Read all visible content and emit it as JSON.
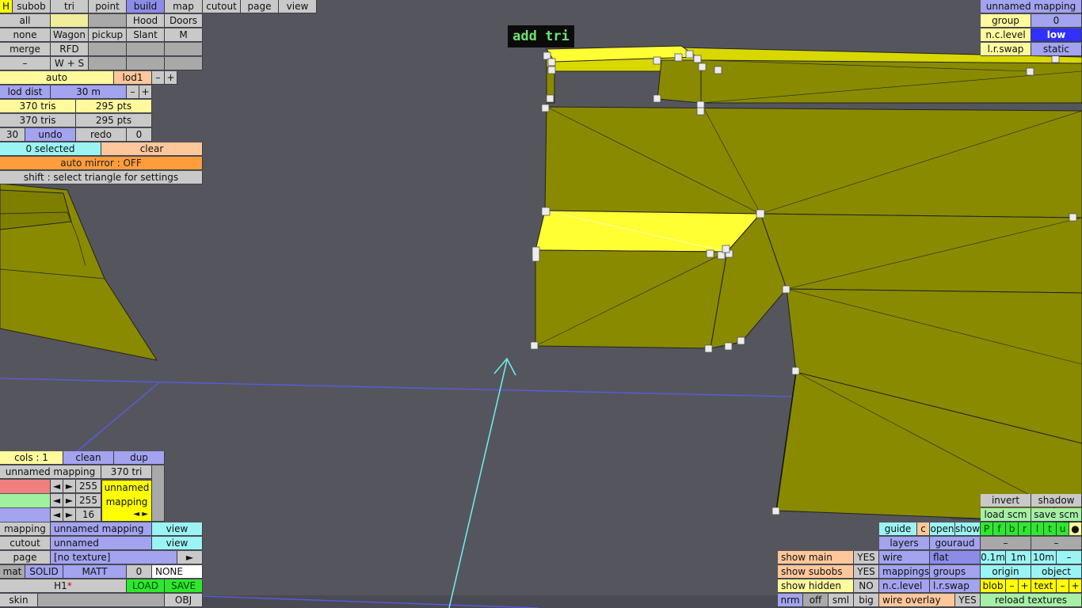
{
  "hud_label": "add tri",
  "top_menu": {
    "h": "H",
    "subob": "subob",
    "tri": "tri",
    "point": "point",
    "build": "build",
    "map": "map",
    "cutout": "cutout",
    "page": "page",
    "view": "view"
  },
  "left_panel": {
    "r1": [
      "all",
      "",
      "",
      "Hood",
      "Doors"
    ],
    "r2": [
      "none",
      "Wagon",
      "pickup",
      "Slant",
      "M"
    ],
    "r3": [
      "merge",
      "RFD",
      "",
      "",
      ""
    ],
    "r4": [
      "–",
      "W + S",
      "",
      "",
      ""
    ],
    "auto": "auto",
    "lod1": "lod1",
    "minus": "–",
    "plus": "+",
    "lod_dist": "lod dist",
    "lod_value": "30 m",
    "tris1": "370 tris",
    "pts1": "295 pts",
    "tris2": "370 tris",
    "pts2": "295 pts",
    "undo_count": "30",
    "undo": "undo",
    "redo": "redo",
    "redo_count": "0",
    "selected": "0 selected",
    "clear": "clear",
    "auto_mirror": "auto mirror : OFF",
    "hint": "shift : select triangle for settings"
  },
  "bottom_left": {
    "cols": "cols : 1",
    "clean": "clean",
    "dup": "dup",
    "mapping_name": "unnamed mapping",
    "tri_count": "370 tri",
    "r_val": "255",
    "g_val": "255",
    "b_val": "16",
    "mapping_box_1": "unnamed",
    "mapping_box_2": "mapping",
    "left_arrow": "◄",
    "right_arrow": "►",
    "mapping_label": "mapping",
    "mapping_value": "unnamed mapping",
    "view1": "view",
    "cutout_label": "cutout",
    "cutout_value": "unnamed",
    "view2": "view",
    "page_label": "page",
    "page_value": "[no texture]",
    "page_arrow": "►",
    "mat": "mat",
    "solid": "SOLID",
    "matt": "MATT",
    "mat_num": "0",
    "none": "NONE",
    "h1": "H1",
    "h1_mark": "*",
    "load": "LOAD",
    "save": "SAVE",
    "skin": "skin",
    "obj": "OBJ"
  },
  "top_right": {
    "unnamed_mapping": "unnamed mapping",
    "group": "group",
    "group_val": "0",
    "nclevel": "n.c.level",
    "nclevel_val": "low",
    "lrswap": "l.r.swap",
    "lrswap_val": "static"
  },
  "bottom_right": {
    "invert": "invert",
    "shadow": "shadow",
    "load_scm": "load scm",
    "save_scm": "save scm",
    "guide": "guide",
    "c": "c",
    "open": "open",
    "show": "show",
    "pfbrltu": [
      "P",
      "f",
      "b",
      "r",
      "l",
      "t",
      "u"
    ],
    "dot": "●",
    "layers": "layers",
    "gouraud": "gouraud",
    "dash1": "–",
    "dash2": "–",
    "show_main": "show main",
    "yes1": "YES",
    "wire": "wire",
    "flat": "flat",
    "m01": "0.1m",
    "m1": "1m",
    "m10": "10m",
    "mdash": "–",
    "show_subobs": "show subobs",
    "yes2": "YES",
    "mappings": "mappings",
    "groups": "groups",
    "origin": "origin",
    "object": "object",
    "show_hidden": "show hidden",
    "no": "NO",
    "nclevel": "n.c.level",
    "lrswap": "l.r.swap",
    "blob": "blob",
    "blob_minus": "–",
    "blob_plus": "+",
    "text": "text",
    "text_minus": "–",
    "text_plus": "+",
    "nrm": "nrm",
    "off": "off",
    "sml": "sml",
    "big": "big",
    "wire_overlay": "wire overlay",
    "yes3": "YES",
    "reload_textures": "reload textures"
  },
  "colors": {
    "background": "#55565d",
    "mesh_face": "#8a8a00",
    "mesh_highlight": "#ffff33",
    "button_blue": "#a3a3f0",
    "button_yellow": "#fffa9c",
    "button_cyan": "#9af4f4",
    "button_orange": "#ffc79a",
    "button_green": "#a5f0a5",
    "hud_text": "#6fe36f"
  }
}
